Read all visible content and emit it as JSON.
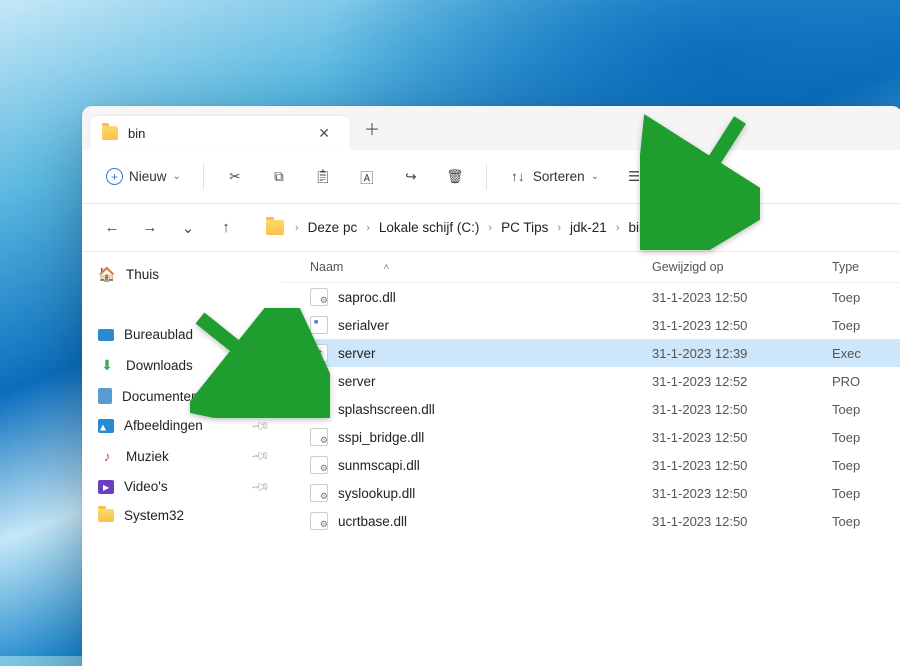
{
  "tab": {
    "title": "bin"
  },
  "toolbar": {
    "new_label": "Nieuw",
    "sort_label": "Sorteren",
    "view_label": "Weergeven"
  },
  "breadcrumbs": [
    "Deze pc",
    "Lokale schijf (C:)",
    "PC Tips",
    "jdk-21",
    "bin"
  ],
  "sidebar": {
    "home": "Thuis",
    "items": [
      {
        "label": "Bureaublad",
        "icon": "desktop",
        "pinned": true
      },
      {
        "label": "Downloads",
        "icon": "download",
        "pinned": true
      },
      {
        "label": "Documenten",
        "icon": "document",
        "pinned": true
      },
      {
        "label": "Afbeeldingen",
        "icon": "pictures",
        "pinned": true
      },
      {
        "label": "Muziek",
        "icon": "music",
        "pinned": true
      },
      {
        "label": "Video's",
        "icon": "video",
        "pinned": true
      },
      {
        "label": "System32",
        "icon": "folder",
        "pinned": false
      }
    ]
  },
  "columns": {
    "name": "Naam",
    "modified": "Gewijzigd op",
    "type": "Type"
  },
  "files": [
    {
      "name": "saproc.dll",
      "modified": "31-1-2023 12:50",
      "type": "Toep",
      "icon": "dll",
      "selected": false
    },
    {
      "name": "serialver",
      "modified": "31-1-2023 12:50",
      "type": "Toep",
      "icon": "exe",
      "selected": false
    },
    {
      "name": "server",
      "modified": "31-1-2023 12:39",
      "type": "Exec",
      "icon": "jar",
      "selected": true
    },
    {
      "name": "server",
      "modified": "31-1-2023 12:52",
      "type": "PRO",
      "icon": "prop",
      "selected": false
    },
    {
      "name": "splashscreen.dll",
      "modified": "31-1-2023 12:50",
      "type": "Toep",
      "icon": "dll",
      "selected": false
    },
    {
      "name": "sspi_bridge.dll",
      "modified": "31-1-2023 12:50",
      "type": "Toep",
      "icon": "dll",
      "selected": false
    },
    {
      "name": "sunmscapi.dll",
      "modified": "31-1-2023 12:50",
      "type": "Toep",
      "icon": "dll",
      "selected": false
    },
    {
      "name": "syslookup.dll",
      "modified": "31-1-2023 12:50",
      "type": "Toep",
      "icon": "dll",
      "selected": false
    },
    {
      "name": "ucrtbase.dll",
      "modified": "31-1-2023 12:50",
      "type": "Toep",
      "icon": "dll",
      "selected": false
    }
  ]
}
